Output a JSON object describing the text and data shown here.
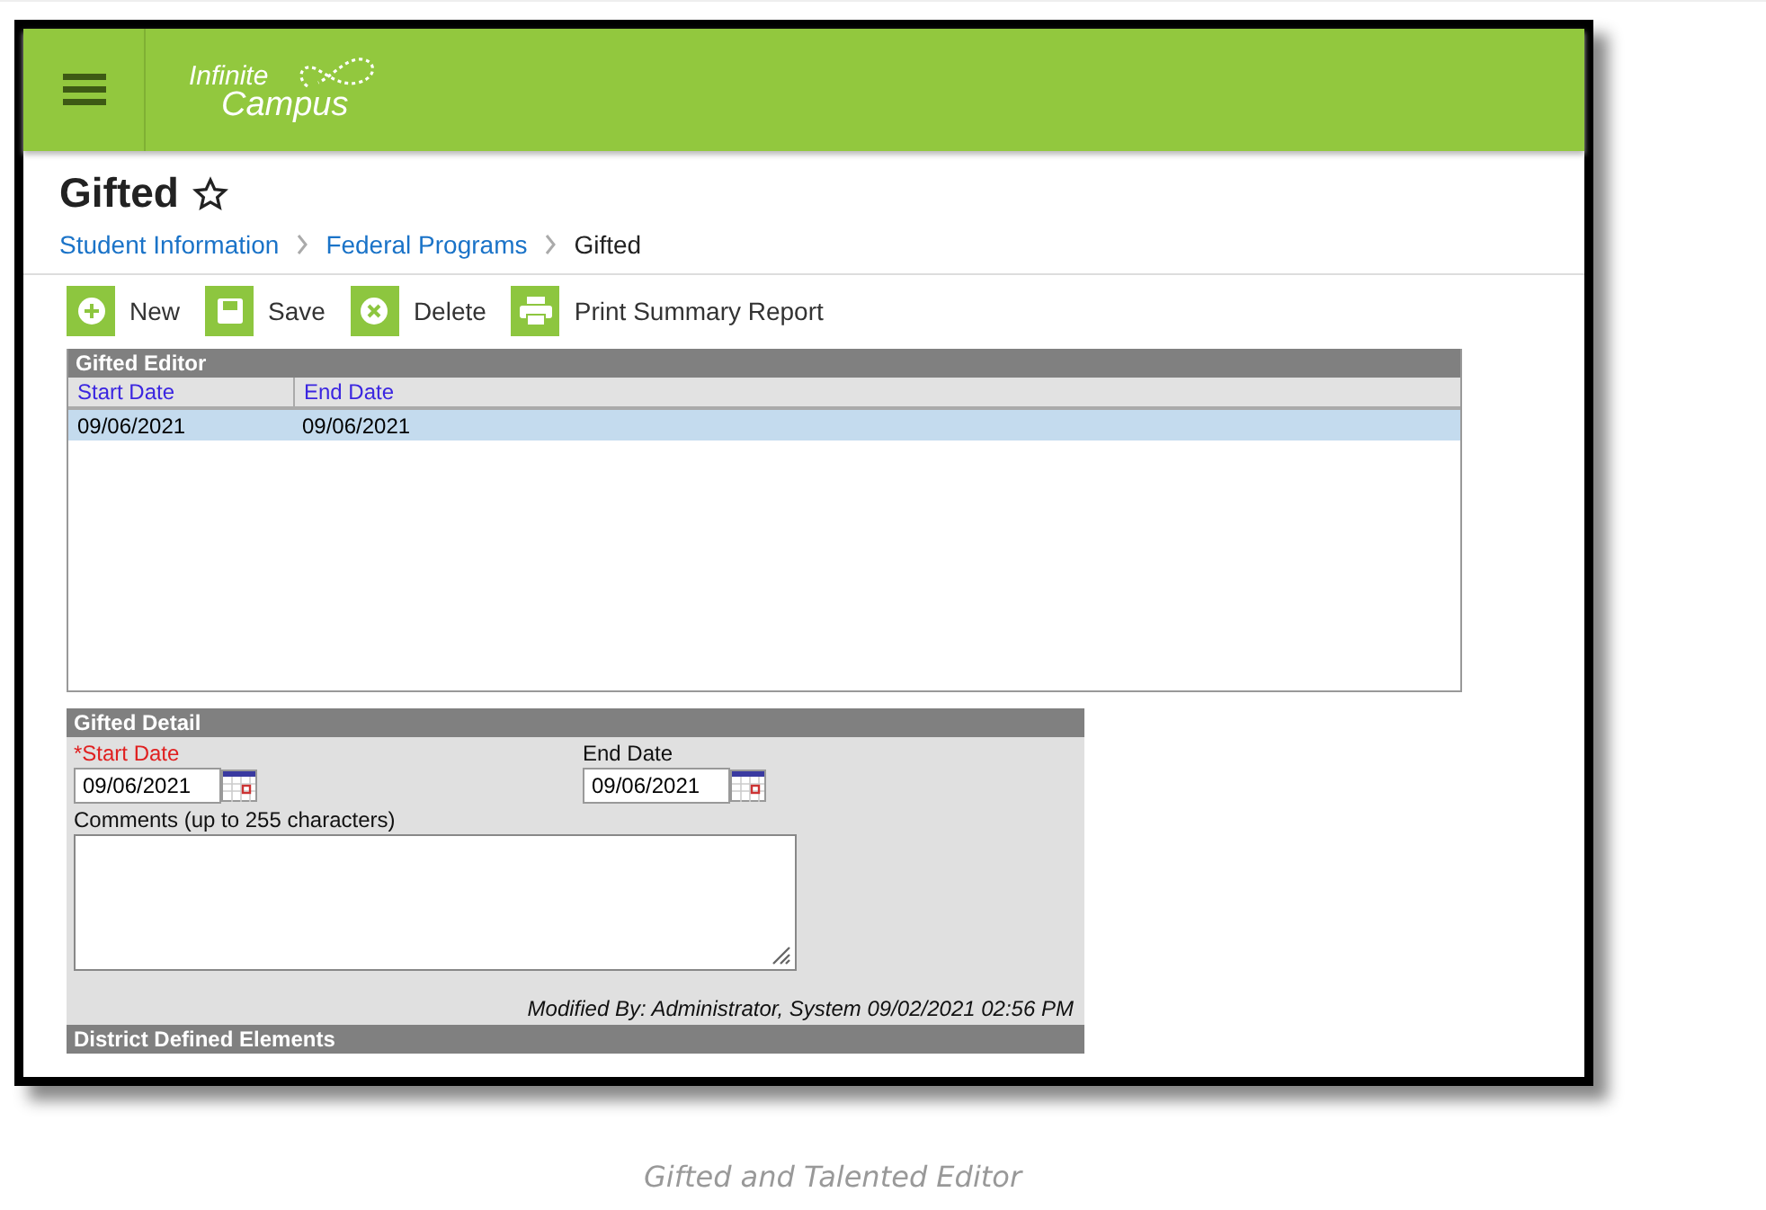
{
  "header": {
    "logo": {
      "line1": "Infinite",
      "line2": "Campus"
    }
  },
  "page": {
    "title": "Gifted",
    "favorite": false,
    "breadcrumbs": [
      {
        "label": "Student Information",
        "kind": "link"
      },
      {
        "label": "Federal Programs",
        "kind": "link"
      },
      {
        "label": "Gifted",
        "kind": "current"
      }
    ]
  },
  "toolbar": [
    {
      "label": "New",
      "kind": "new"
    },
    {
      "label": "Save",
      "kind": "save"
    },
    {
      "label": "Delete",
      "kind": "delete"
    },
    {
      "label": "Print Summary Report",
      "kind": "print"
    }
  ],
  "editor": {
    "title": "Gifted Editor",
    "columns": [
      "Start Date",
      "End Date"
    ],
    "rows": [
      {
        "cells": [
          "09/06/2021",
          "09/06/2021"
        ],
        "selected": true
      }
    ]
  },
  "detail": {
    "title": "Gifted Detail",
    "fields": [
      {
        "label": "*Start Date",
        "required": true,
        "value": "09/06/2021"
      },
      {
        "label": "End Date",
        "required": false,
        "value": "09/06/2021"
      }
    ],
    "comments": {
      "label": "Comments (up to 255 characters)"
    },
    "modified": "Modified By: Administrator, System 09/02/2021 02:56 PM",
    "section": "District Defined Elements"
  },
  "caption": "Gifted and Talented Editor"
}
